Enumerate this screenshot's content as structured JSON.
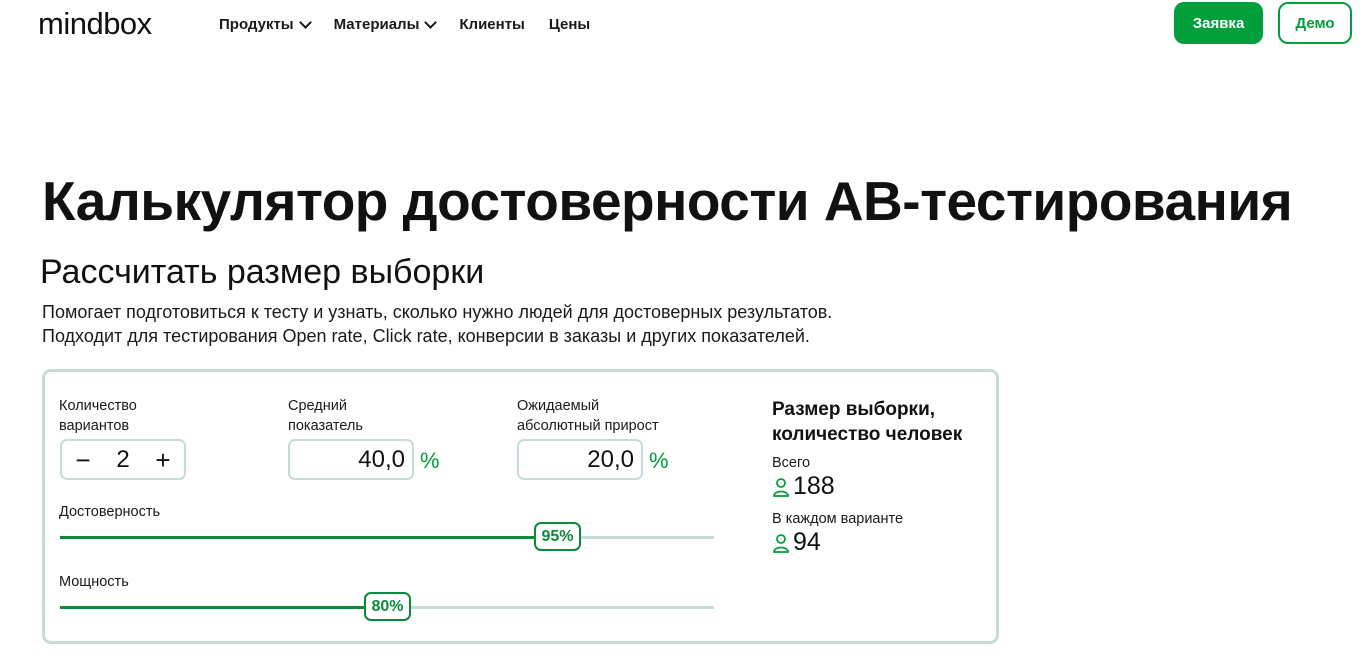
{
  "header": {
    "logo": "mindbox",
    "nav": [
      {
        "label": "Продукты",
        "dropdown": true
      },
      {
        "label": "Материалы",
        "dropdown": true
      },
      {
        "label": "Клиенты",
        "dropdown": false
      },
      {
        "label": "Цены",
        "dropdown": false
      }
    ],
    "primary_button": "Заявка",
    "secondary_button": "Демо"
  },
  "page": {
    "title": "Калькулятор достоверности АВ-тестирования",
    "subtitle": "Рассчитать размер выборки",
    "description_line1": "Помогает подготовиться к тесту и узнать, сколько нужно людей для достоверных результатов.",
    "description_line2": "Подходит для тестирования Open rate, Click rate, конверсии в заказы и других показателей."
  },
  "calculator": {
    "variants": {
      "label_line1": "Количество",
      "label_line2": "вариантов",
      "value": "2",
      "minus": "−",
      "plus": "+"
    },
    "average": {
      "label_line1": "Средний",
      "label_line2": "показатель",
      "value": "40,0",
      "unit": "%"
    },
    "uplift": {
      "label_line1": "Ожидаемый",
      "label_line2": "абсолютный прирост",
      "value": "20,0",
      "unit": "%"
    },
    "confidence": {
      "label": "Достоверность",
      "value_text": "95%",
      "position_fraction": 0.76
    },
    "power": {
      "label": "Мощность",
      "value_text": "80%",
      "position_fraction": 0.5
    }
  },
  "result": {
    "title_line1": "Размер выборки,",
    "title_line2": "количество человек",
    "total_label": "Всего",
    "total_value": "188",
    "per_variant_label": "В каждом варианте",
    "per_variant_value": "94"
  },
  "colors": {
    "accent": "#009f3c",
    "border": "#c5dcd9"
  }
}
